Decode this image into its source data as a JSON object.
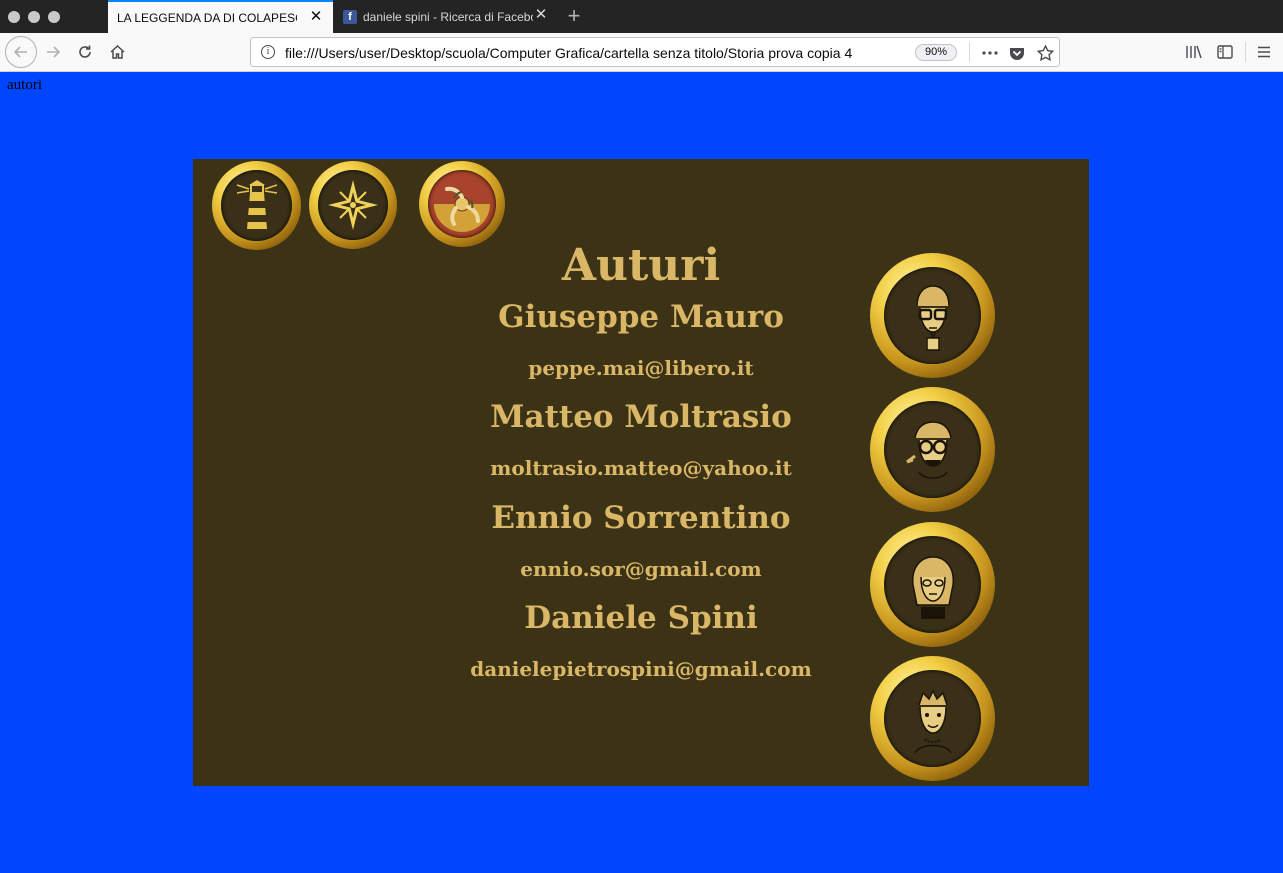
{
  "browser": {
    "tabs": [
      {
        "title": "LA LEGGENDA DA DI COLAPESCE",
        "active": true
      },
      {
        "title": "daniele spini - Ricerca di Facebook",
        "active": false,
        "favicon": "facebook-icon"
      }
    ],
    "url": "file:///Users/user/Desktop/scuola/Computer Grafica/cartella senza titolo/Storia prova copia 4",
    "zoom": "90%",
    "toolbar_icons": [
      "back-icon",
      "forward-icon",
      "reload-icon",
      "home-icon",
      "info-icon",
      "more-icon",
      "pocket-icon",
      "bookmark-star-icon",
      "library-icon",
      "sidebar-icon",
      "menu-icon"
    ]
  },
  "page": {
    "label": "autori",
    "background": "#0046ff",
    "card": {
      "background": "#3c3216",
      "text_color": "#d9b766",
      "title": "Auturi",
      "top_icons": [
        "lighthouse-icon",
        "compass-rose-icon",
        "trinacria-icon"
      ],
      "authors": [
        {
          "name": "Giuseppe Mauro",
          "email": "peppe.mai@libero.it",
          "portrait": "portrait-giuseppe-icon"
        },
        {
          "name": "Matteo Moltrasio",
          "email": "moltrasio.matteo@yahoo.it",
          "portrait": "portrait-matteo-icon"
        },
        {
          "name": "Ennio Sorrentino",
          "email": "ennio.sor@gmail.com",
          "portrait": "portrait-ennio-icon"
        },
        {
          "name": "Daniele Spini",
          "email": "danielepietrospini@gmail.com",
          "portrait": "portrait-daniele-icon"
        }
      ]
    }
  }
}
